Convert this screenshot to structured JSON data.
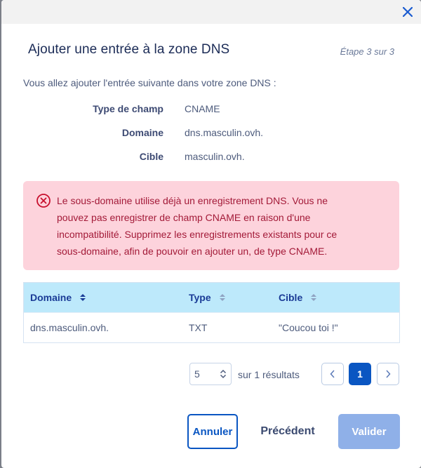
{
  "modal": {
    "close_icon": "close-icon",
    "title": "Ajouter une entrée à la zone DNS",
    "step": "Étape 3 sur 3",
    "intro": "Vous allez ajouter l'entrée suivante dans votre zone DNS :"
  },
  "summary": [
    {
      "key": "Type de champ",
      "value": "CNAME"
    },
    {
      "key": "Domaine",
      "value": "dns.masculin.ovh."
    },
    {
      "key": "Cible",
      "value": "masculin.ovh."
    }
  ],
  "alert": {
    "icon": "error-circle-icon",
    "lines": [
      "Le sous-domaine utilise déjà un enregistrement DNS. Vous ne",
      "pouvez pas enregistrer de champ CNAME en raison d'une",
      "incompatibilité. Supprimez les enregistrements existants pour ce",
      "sous-domaine, afin de pouvoir en ajouter un, de type CNAME."
    ],
    "color_bg": "#fdd3dc",
    "color_text": "#a31a38"
  },
  "table": {
    "columns": [
      "Domaine",
      "Type",
      "Cible"
    ],
    "rows": [
      [
        "dns.masculin.ovh.",
        "TXT",
        "\"Coucou toi !\""
      ]
    ]
  },
  "pagination": {
    "page_size": "5",
    "results_label": "sur 1 résultats",
    "current_page": "1"
  },
  "actions": {
    "cancel": "Annuler",
    "previous": "Précédent",
    "validate": "Valider"
  },
  "colors": {
    "primary": "#0a56c2",
    "header_bg": "#bde9fb",
    "disabled": "#8fb0e8"
  }
}
